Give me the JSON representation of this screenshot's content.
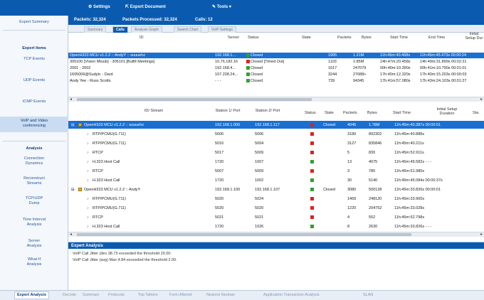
{
  "toolbar": {
    "settings_label": "Settings",
    "export_label": "Export Document",
    "tools_label": "Tools"
  },
  "stats": {
    "packets": "Packets: 32,324",
    "processed": "Packets Processed: 32,324",
    "calls": "Calls: 12"
  },
  "tabs": [
    "Summary",
    "Calls",
    "Analysis Graph",
    "Search Chart",
    "VoIP Settings"
  ],
  "active_tab": "Calls",
  "sidebar": {
    "expert_summary": "Expert Summary",
    "expert_items_head": "Expert Items",
    "items": [
      "TCP Events",
      "UDP Events",
      "ICMP Events",
      "VoIP and Video conferencing"
    ],
    "analysis_head": "Analysis",
    "analysis_items": [
      "Connection Dynamics",
      "Reconstruct Streams",
      "TCP/UDP Dump",
      "Time Interval Analysis",
      "Server Analysis",
      "What-If Analysis"
    ]
  },
  "calls_table": {
    "columns": [
      "ID",
      "Server",
      "Status",
      "State",
      "Packets",
      "Bytes",
      "Start Time",
      "End Time",
      "Initial Setup Dur"
    ],
    "rows": [
      {
        "id": "OpenH323 MCU v1.2.2 :: AndyY :: suuuehz",
        "server": "192.168.1...",
        "status": "Closed",
        "packets": "1905",
        "bytes": "1.21M",
        "start": "11h:45m:40.468s",
        "end": "11h:45m:45.473s 00:00:24",
        "selected": true
      },
      {
        "id": "305100 [Vision Mtuub] - 305101 [ButM Meetings]",
        "server": "10.76.182.16",
        "status": "Closed [Timed Out]",
        "packets": "1103",
        "bytes": "2.85M",
        "start": "14h:47m:20.458s",
        "end": "14h:49m:31.899s 00:02:21",
        "selected": false
      },
      {
        "id": "2001 - 2002",
        "server": "192.168.4...",
        "status": "Closed",
        "packets": "1017",
        "bytes": "247079",
        "start": "00h:40m:10.390s",
        "end": "00h:41m:10.790s 00:01:01",
        "selected": false
      },
      {
        "id": "1605006@Sudytc - Dard",
        "server": "107.228.24...",
        "status": "Closed",
        "packets": "3244",
        "bytes": "27088+",
        "start": "17h:40m:12.320s",
        "end": "17h:40m:15.203s 00:00:03",
        "selected": false
      },
      {
        "id": "Andy Yee - Russ Scotts",
        "server": "- - -",
        "status": "Closed",
        "packets": "739",
        "bytes": "94345",
        "start": "17h:41m:57.080s",
        "end": "17h:43m:24.103s 00:01:27",
        "selected": false
      }
    ]
  },
  "streams_table": {
    "columns": [
      "ID/ Stream",
      "Station 1/ Port",
      "Station 2/ Port",
      "Status",
      "State",
      "Packets",
      "Bytes",
      "Start Time",
      "Initial Setup Duration",
      "Sta"
    ],
    "rows": [
      {
        "level": 0,
        "name": "OpenH323 MCU v1.2.2 :: suuuehz",
        "p1": "192.168.1.000",
        "p2": "192.168.1.117",
        "status_color": "#e02020",
        "state": "Closed",
        "packets": "4046",
        "bytes": "1.78M",
        "start": "11h:45m:40.387s 00:00:01",
        "selected": true
      },
      {
        "level": 1,
        "name": "RTP/PCMU(G.711)",
        "p1": "5006",
        "p2": "5006",
        "status_color": "#e02020",
        "state": "",
        "packets": "3189",
        "bytes": "892302",
        "start": "11h:45m:40.888s",
        "selected": false
      },
      {
        "level": 1,
        "name": "RTP/PCMU(G.711)",
        "p1": "5016",
        "p2": "5004",
        "status_color": "#e02020",
        "state": "",
        "packets": "3127",
        "bytes": "835846",
        "start": "11h:45m:40.211s",
        "selected": false
      },
      {
        "level": 1,
        "name": "RTCP",
        "p1": "5017",
        "p2": "5009",
        "status_color": "#e02020",
        "state": "",
        "packets": "5",
        "bytes": "830",
        "start": "11h:45m:52.911s",
        "selected": false
      },
      {
        "level": 1,
        "name": "H.323 Host Call",
        "p1": "1720",
        "p2": "1007",
        "status_color": "#30a030",
        "state": "",
        "packets": "13",
        "bytes": "4075",
        "start": "11h:45m:45.582s - - -",
        "selected": false
      },
      {
        "level": 1,
        "name": "RTCP",
        "p1": "5007",
        "p2": "5009",
        "status_color": "#e02020",
        "state": "",
        "packets": "3",
        "bytes": "780",
        "start": "11h:45m:51.980s",
        "selected": false
      },
      {
        "level": 1,
        "name": "H.323 Host Call",
        "p1": "1720",
        "p2": "1002",
        "status_color": "#30a030",
        "state": "",
        "packets": "30",
        "bytes": "5140",
        "start": "11h:45m:45.084s 00:00:37s",
        "selected": false
      },
      {
        "level": 0,
        "name": "OpenH323 MCU v1.2.2 :: AndyY",
        "p1": "192.168.1.100",
        "p2": "192.168.1.107",
        "status_color": "#30a030",
        "state": "Closed",
        "packets": "3080",
        "bytes": "500128",
        "start": "11h:45m:33.826s 00:00:01",
        "selected": false
      },
      {
        "level": 1,
        "name": "RTP/PCMU(G.711)",
        "p1": "5020",
        "p2": "5024",
        "status_color": "#e02020",
        "state": "",
        "packets": "1469",
        "bytes": "248120",
        "start": "11h:45m:33.900s",
        "selected": false
      },
      {
        "level": 1,
        "name": "RTP/PCMU(G.711)",
        "p1": "5020",
        "p2": "5020",
        "status_color": "#e02020",
        "state": "",
        "packets": "1220",
        "bytes": "204752",
        "start": "11h:45m:33.028s",
        "selected": false
      },
      {
        "level": 1,
        "name": "RTCP",
        "p1": "5021",
        "p2": "5021",
        "status_color": "#e02020",
        "state": "",
        "packets": "4",
        "bytes": "552",
        "start": "11h:45m:52.798s",
        "selected": false
      },
      {
        "level": 1,
        "name": "H.323 Host Call",
        "p1": "1720",
        "p2": "1026",
        "status_color": "#30a030",
        "state": "",
        "packets": "8",
        "bytes": "2630",
        "start": "11h:45m:33.826s - - -",
        "selected": false
      }
    ]
  },
  "expert_analysis": {
    "title": "Expert Analysis",
    "messages": [
      "VoIP Call Jitter (dev 38.73 exceeded the threshold 20.00.",
      "VoIP Call Jitter (avg) Max 4.84 exceeded the threshold 2.00."
    ]
  },
  "bottom_tabs": [
    "Expert Analysis",
    "Decode",
    "Summary",
    "Protocols",
    "Top Talkers",
    "Form Altered",
    "Nearest Neuhan",
    "Application Transaction Analysis",
    "SLAN"
  ],
  "active_bottom_tab": "Expert Analysis",
  "colors": {
    "accent": "#0a5bb0",
    "selection": "#1b6fd0",
    "status_red": "#e02020",
    "status_green": "#30a030"
  }
}
